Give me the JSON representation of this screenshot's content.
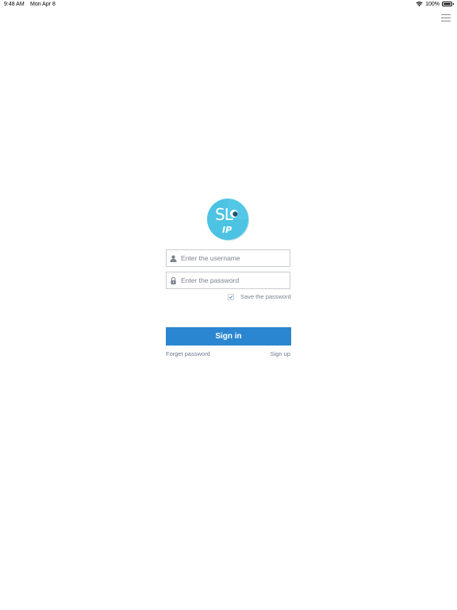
{
  "status_bar": {
    "time": "9:48 AM",
    "date": "Mon Apr 8",
    "battery": "100%"
  },
  "menu": {
    "icon": "hamburger-menu-icon"
  },
  "logo": {
    "main_text": "SL",
    "sub_text": "IP",
    "colors": {
      "circle": "#4cc3e3",
      "circle_shadow": "#2f9fc2",
      "text": "#ffffff"
    }
  },
  "login": {
    "username_placeholder": "Enter the username",
    "password_placeholder": "Enter the password",
    "save_password_label": "Save the password",
    "save_password_checked": true,
    "sign_in_label": "Sign in",
    "forget_password_label": "Forget password",
    "sign_up_label": "Sign up"
  },
  "colors": {
    "accent": "#2a86d1",
    "border": "#c9ccd1",
    "muted_text": "#7d8290"
  }
}
